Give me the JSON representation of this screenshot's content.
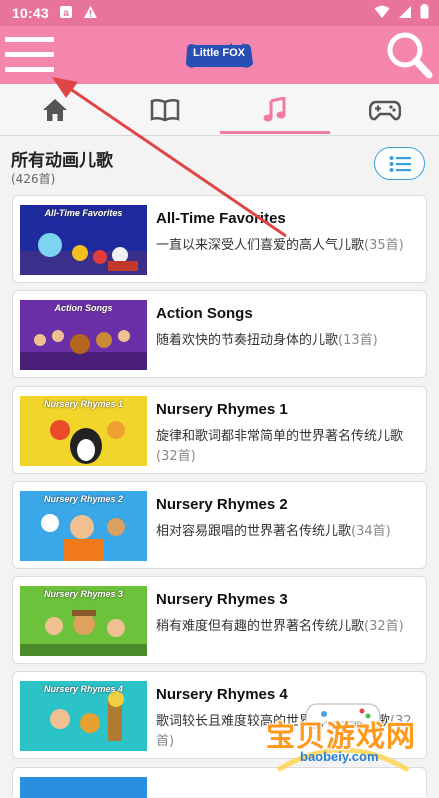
{
  "status_bar": {
    "time": "10:43",
    "icons": [
      "notification-a-icon",
      "warning-icon",
      "wifi-icon",
      "signal-icon",
      "battery-icon"
    ]
  },
  "app_bar": {
    "logo_text": "Little FOX",
    "menu_icon": "hamburger-menu-icon",
    "search_icon": "search-icon",
    "background": "#f486ad"
  },
  "tabs": [
    {
      "name": "home",
      "icon": "home-icon",
      "active": false
    },
    {
      "name": "book",
      "icon": "book-icon",
      "active": false
    },
    {
      "name": "songs",
      "icon": "music-note-icon",
      "active": true
    },
    {
      "name": "games",
      "icon": "gamepad-icon",
      "active": false
    }
  ],
  "section": {
    "title": "所有动画儿歌",
    "count": "(426首)"
  },
  "items": [
    {
      "title": "All-Time Favorites",
      "desc": "一直以来深受人们喜爱的高人气儿歌",
      "count": "(35首)",
      "thumb_label": "All-Time Favorites",
      "thumb_bg": "#1f2a9e"
    },
    {
      "title": "Action Songs",
      "desc": "随着欢快的节奏扭动身体的儿歌",
      "count": "(13首)",
      "thumb_label": "Action Songs",
      "thumb_bg": "#6b2fa8"
    },
    {
      "title": "Nursery Rhymes 1",
      "desc": "旋律和歌词都非常简单的世界著名传统儿歌",
      "count": "(32首)",
      "thumb_label": "Nursery Rhymes 1",
      "thumb_bg": "#f2d52a"
    },
    {
      "title": "Nursery Rhymes 2",
      "desc": "相对容易跟唱的世界著名传统儿歌",
      "count": "(34首)",
      "thumb_label": "Nursery Rhymes 2",
      "thumb_bg": "#3aa8e8"
    },
    {
      "title": "Nursery Rhymes 3",
      "desc": "稍有难度但有趣的世界著名传统儿歌",
      "count": "(32首)",
      "thumb_label": "Nursery Rhymes 3",
      "thumb_bg": "#6cc23a"
    },
    {
      "title": "Nursery Rhymes 4",
      "desc": "歌词较长且难度较高的世界著名传统儿歌",
      "count": "(32首)",
      "thumb_label": "Nursery Rhymes 4",
      "thumb_bg": "#2cc3c8"
    }
  ],
  "watermark": {
    "text": "宝贝游戏网",
    "url": "baobeiy.com"
  },
  "colors": {
    "status": "#e8749d",
    "accent": "#f07aa5",
    "list_button": "#3aa0d8",
    "arrow": "#e04545"
  }
}
